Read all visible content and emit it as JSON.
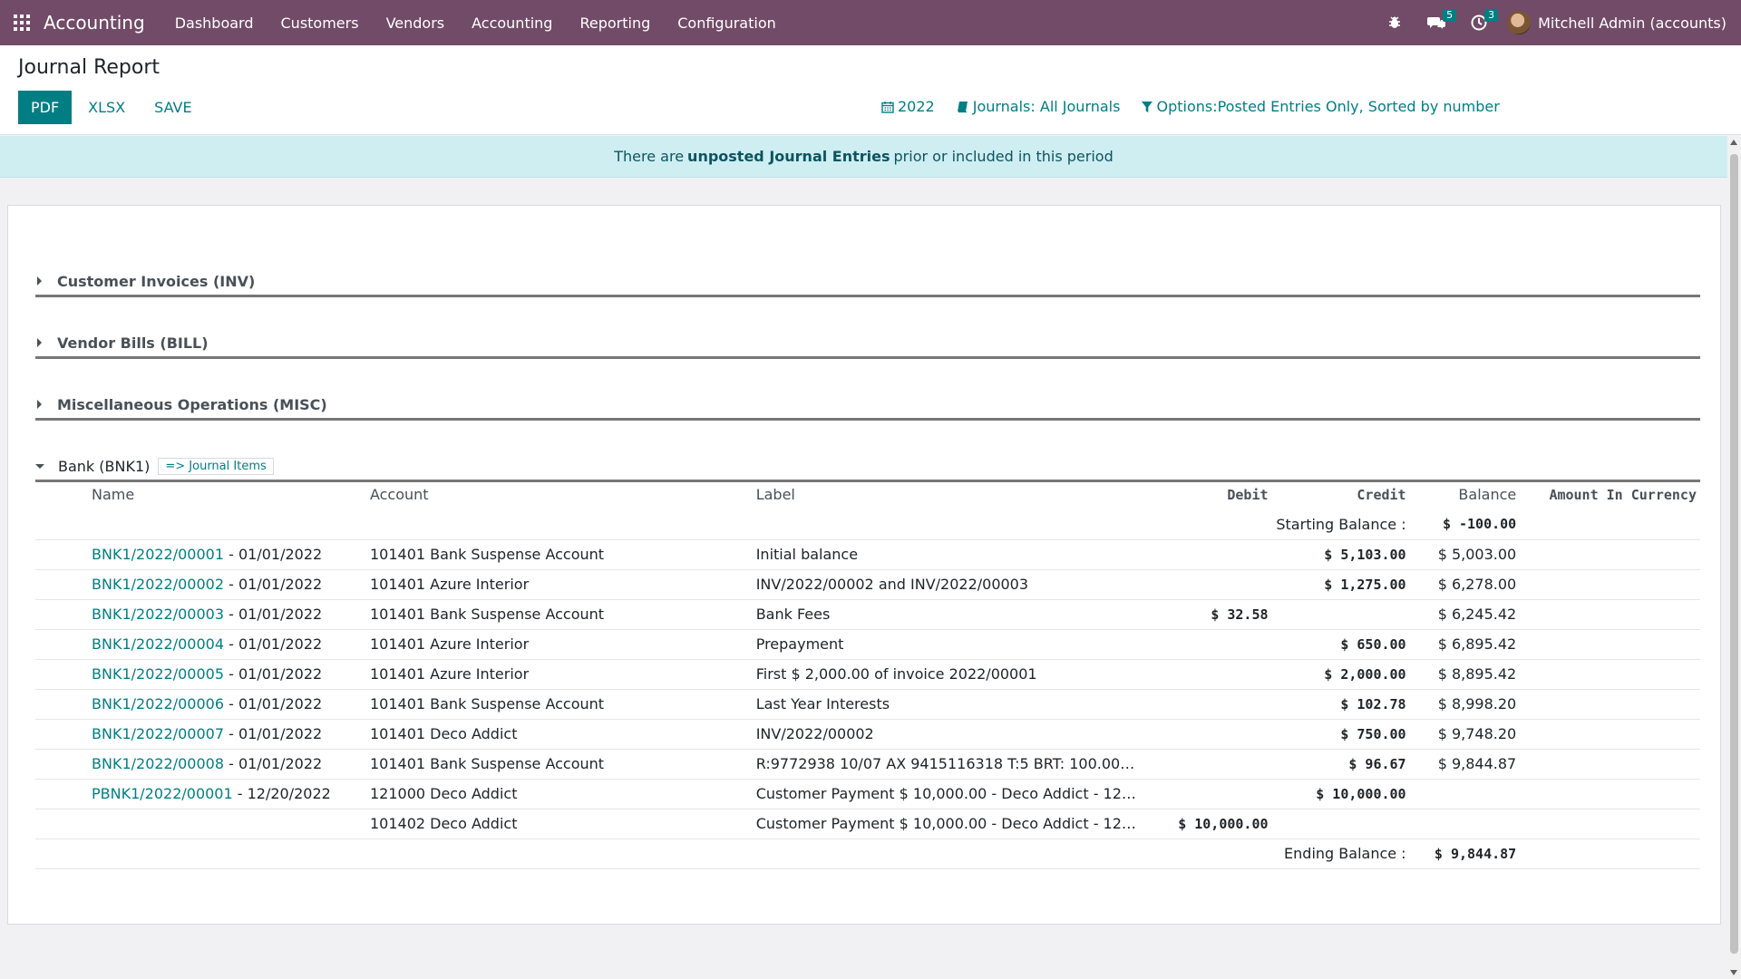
{
  "navbar": {
    "app_name": "Accounting",
    "menu": [
      "Dashboard",
      "Customers",
      "Vendors",
      "Accounting",
      "Reporting",
      "Configuration"
    ],
    "messages_count": "5",
    "activities_count": "3",
    "user_name": "Mitchell Admin (accounts)",
    "icons": [
      "apps-grid-icon",
      "bug-icon",
      "chat-icon",
      "clock-icon"
    ],
    "bar_color": "#714b67"
  },
  "control_panel": {
    "title": "Journal Report",
    "buttons": {
      "pdf": "PDF",
      "xlsx": "XLSX",
      "save": "SAVE"
    },
    "filters": {
      "date": "2022",
      "journals": "Journals: All Journals",
      "options": "Options:Posted Entries Only, Sorted by number"
    }
  },
  "alert": {
    "prefix": "There are",
    "strong": "unposted Journal Entries",
    "suffix": "prior or included in this period"
  },
  "sections": {
    "inv": "Customer Invoices (INV)",
    "bill": "Vendor Bills (BILL)",
    "misc": "Miscellaneous Operations (MISC)",
    "bank": "Bank (BNK1)",
    "journal_items_link": "=> Journal Items"
  },
  "table": {
    "headers": {
      "name": "Name",
      "account": "Account",
      "label": "Label",
      "debit": "Debit",
      "credit": "Credit",
      "balance": "Balance",
      "amount_currency": "Amount In Currency"
    },
    "starting_label": "Starting Balance :",
    "starting_value": "$ -100.00",
    "ending_label": "Ending Balance :",
    "ending_value": "$ 9,844.87",
    "rows": [
      {
        "ref": "BNK1/2022/00001",
        "date": " - 01/01/2022",
        "acc_code": "101401",
        "acc_name": "Bank Suspense Account",
        "label": "Initial balance",
        "debit": "",
        "credit": "$ 5,103.00",
        "balance": "$ 5,003.00"
      },
      {
        "ref": "BNK1/2022/00002",
        "date": " - 01/01/2022",
        "acc_code": "101401",
        "acc_name": "Azure Interior",
        "label": "INV/2022/00002 and INV/2022/00003",
        "debit": "",
        "credit": "$ 1,275.00",
        "balance": "$ 6,278.00"
      },
      {
        "ref": "BNK1/2022/00003",
        "date": " - 01/01/2022",
        "acc_code": "101401",
        "acc_name": "Bank Suspense Account",
        "label": "Bank Fees",
        "debit": "$ 32.58",
        "credit": "",
        "balance": "$ 6,245.42"
      },
      {
        "ref": "BNK1/2022/00004",
        "date": " - 01/01/2022",
        "acc_code": "101401",
        "acc_name": "Azure Interior",
        "label": "Prepayment",
        "debit": "",
        "credit": "$ 650.00",
        "balance": "$ 6,895.42"
      },
      {
        "ref": "BNK1/2022/00005",
        "date": " - 01/01/2022",
        "acc_code": "101401",
        "acc_name": "Azure Interior",
        "label": "First $ 2,000.00 of invoice 2022/00001",
        "debit": "",
        "credit": "$ 2,000.00",
        "balance": "$ 8,895.42"
      },
      {
        "ref": "BNK1/2022/00006",
        "date": " - 01/01/2022",
        "acc_code": "101401",
        "acc_name": "Bank Suspense Account",
        "label": "Last Year Interests",
        "debit": "",
        "credit": "$ 102.78",
        "balance": "$ 8,998.20"
      },
      {
        "ref": "BNK1/2022/00007",
        "date": " - 01/01/2022",
        "acc_code": "101401",
        "acc_name": "Deco Addict",
        "label": "INV/2022/00002",
        "debit": "",
        "credit": "$ 750.00",
        "balance": "$ 9,748.20"
      },
      {
        "ref": "BNK1/2022/00008",
        "date": " - 01/01/2022",
        "acc_code": "101401",
        "acc_name": "Bank Suspense Account",
        "label": "R:9772938 10/07 AX 9415116318 T:5 BRT: 100.00…",
        "debit": "",
        "credit": "$ 96.67",
        "balance": "$ 9,844.87"
      },
      {
        "ref": "PBNK1/2022/00001",
        "date": " - 12/20/2022",
        "acc_code": "121000",
        "acc_name": "Deco Addict",
        "label": "Customer Payment $ 10,000.00 - Deco Addict - 12…",
        "debit": "",
        "credit": "$ 10,000.00",
        "balance": ""
      },
      {
        "ref": "",
        "date": "",
        "acc_code": "101402",
        "acc_name": "Deco Addict",
        "label": "Customer Payment $ 10,000.00 - Deco Addict - 12…",
        "debit": "$ 10,000.00",
        "credit": "",
        "balance": ""
      }
    ]
  },
  "colors": {
    "accent": "#017e84",
    "link_blue": "#1a78c2",
    "negative": "#dc2c41",
    "alert_bg": "#cfeef2"
  }
}
